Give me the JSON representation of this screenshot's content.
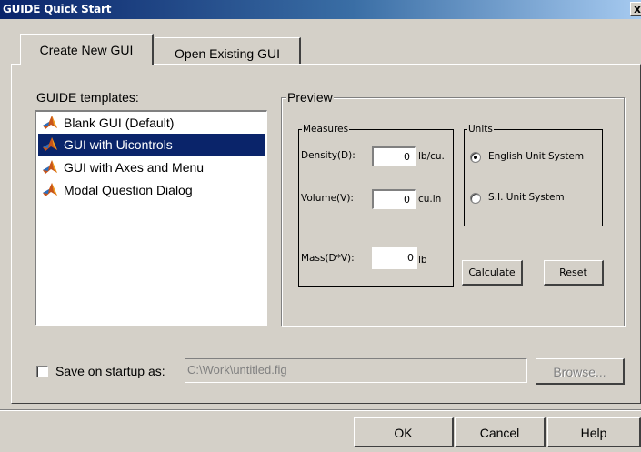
{
  "window": {
    "title": "GUIDE Quick Start",
    "close_glyph": "x"
  },
  "tabs": [
    {
      "label": "Create New GUI",
      "active": true
    },
    {
      "label": "Open Existing GUI",
      "active": false
    }
  ],
  "templates": {
    "label": "GUIDE templates:",
    "items": [
      {
        "label": "Blank GUI (Default)",
        "icon": "matlab-icon",
        "selected": false
      },
      {
        "label": "GUI with Uicontrols",
        "icon": "matlab-icon",
        "selected": true
      },
      {
        "label": "GUI with Axes and Menu",
        "icon": "matlab-icon",
        "selected": false
      },
      {
        "label": "Modal Question Dialog",
        "icon": "matlab-icon",
        "selected": false
      }
    ]
  },
  "preview": {
    "title": "Preview",
    "measures": {
      "title": "Measures",
      "density_label": "Density(D):",
      "density_value": "0",
      "density_unit": "lb/cu.",
      "volume_label": "Volume(V):",
      "volume_value": "0",
      "volume_unit": "cu.in",
      "mass_label": "Mass(D*V):",
      "mass_value": "0",
      "mass_unit": "lb"
    },
    "units": {
      "title": "Units",
      "options": [
        {
          "label": "English Unit System",
          "checked": true
        },
        {
          "label": "S.I. Unit System",
          "checked": false
        }
      ]
    },
    "calculate_label": "Calculate",
    "reset_label": "Reset"
  },
  "startup": {
    "checkbox_label": "Save on startup as:",
    "checked": false,
    "path_value": "C:\\Work\\untitled.fig",
    "browse_label": "Browse..."
  },
  "footer": {
    "ok_label": "OK",
    "cancel_label": "Cancel",
    "help_label": "Help"
  },
  "colors": {
    "face": "#d4d0c8",
    "selection": "#0a246a",
    "titlebar": "#0a246a"
  }
}
